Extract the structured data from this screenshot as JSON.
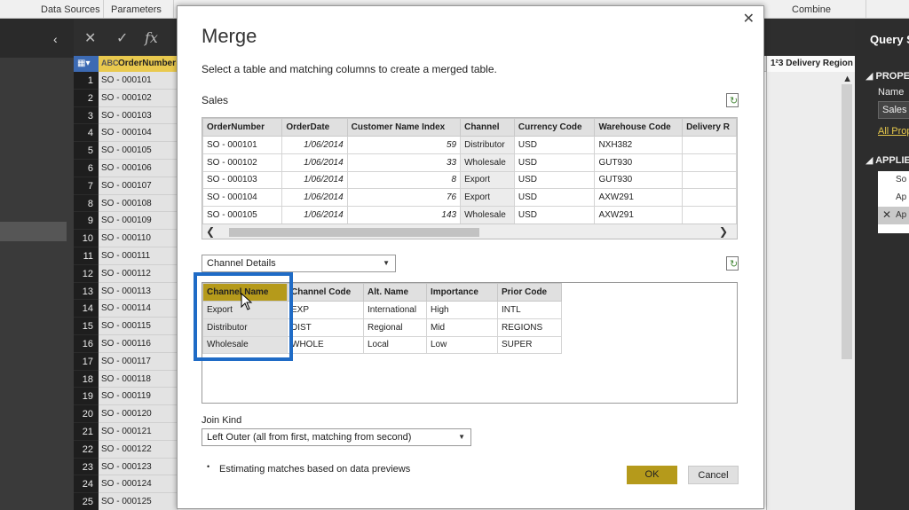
{
  "ribbon": {
    "data_sources": "Data Sources",
    "parameters": "Parameters",
    "combine": "Combine"
  },
  "grid": {
    "column1": "OrderNumber",
    "column_right": "Delivery Region",
    "column_right_type": "1²3",
    "row_numbers": [
      "1",
      "2",
      "3",
      "4",
      "5",
      "6",
      "7",
      "8",
      "9",
      "10",
      "11",
      "12",
      "13",
      "14",
      "15",
      "16",
      "17",
      "18",
      "19",
      "20",
      "21",
      "22",
      "23",
      "24",
      "25"
    ],
    "order_numbers": [
      "SO - 000101",
      "SO - 000102",
      "SO - 000103",
      "SO - 000104",
      "SO - 000105",
      "SO - 000106",
      "SO - 000107",
      "SO - 000108",
      "SO - 000109",
      "SO - 000110",
      "SO - 000111",
      "SO - 000112",
      "SO - 000113",
      "SO - 000114",
      "SO - 000115",
      "SO - 000116",
      "SO - 000117",
      "SO - 000118",
      "SO - 000119",
      "SO - 000120",
      "SO - 000121",
      "SO - 000122",
      "SO - 000123",
      "SO - 000124",
      "SO - 000125"
    ]
  },
  "right_panel": {
    "title": "Query S",
    "properties": "PROPE",
    "name_label": "Name",
    "name_value": "Sales",
    "all_props": "All Prop",
    "applied": "APPLIE",
    "steps": [
      "So",
      "Ap",
      "Ap"
    ]
  },
  "dialog": {
    "title": "Merge",
    "subtitle": "Select a table and matching columns to create a merged table.",
    "first_table_label": "Sales",
    "table1": {
      "headers": [
        "OrderNumber",
        "OrderDate",
        "Customer Name Index",
        "Channel",
        "Currency Code",
        "Warehouse Code",
        "Delivery R"
      ],
      "rows": [
        [
          "SO - 000101",
          "1/06/2014",
          "59",
          "Distributor",
          "USD",
          "NXH382",
          ""
        ],
        [
          "SO - 000102",
          "1/06/2014",
          "33",
          "Wholesale",
          "USD",
          "GUT930",
          ""
        ],
        [
          "SO - 000103",
          "1/06/2014",
          "8",
          "Export",
          "USD",
          "GUT930",
          ""
        ],
        [
          "SO - 000104",
          "1/06/2014",
          "76",
          "Export",
          "USD",
          "AXW291",
          ""
        ],
        [
          "SO - 000105",
          "1/06/2014",
          "143",
          "Wholesale",
          "USD",
          "AXW291",
          ""
        ]
      ]
    },
    "second_table_select": "Channel Details",
    "table2": {
      "headers": [
        "Channel Name",
        "Channel Code",
        "Alt. Name",
        "Importance",
        "Prior Code"
      ],
      "rows": [
        [
          "Export",
          "EXP",
          "International",
          "High",
          "INTL"
        ],
        [
          "Distributor",
          "DIST",
          "Regional",
          "Mid",
          "REGIONS"
        ],
        [
          "Wholesale",
          "WHOLE",
          "Local",
          "Low",
          "SUPER"
        ]
      ]
    },
    "join_kind_label": "Join Kind",
    "join_kind_value": "Left Outer (all from first, matching from second)",
    "note": "Estimating matches based on data previews",
    "ok": "OK",
    "cancel": "Cancel"
  },
  "colors": {
    "accent": "#b59a1b",
    "highlight_box": "#1f6bc6",
    "header_gold": "#e9c94e"
  }
}
